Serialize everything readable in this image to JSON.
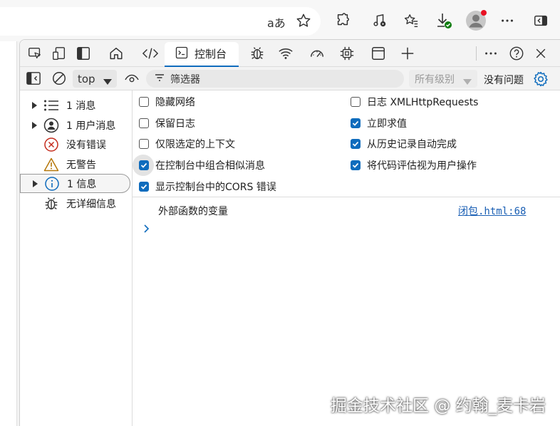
{
  "browser": {
    "read_aloud_glyph": "aあ",
    "icons": [
      "read-aloud-icon",
      "favorite-star-icon",
      "extensions-icon",
      "media-control-icon",
      "favorites-list-icon",
      "downloads-icon",
      "profile-avatar-icon",
      "more-options-icon",
      "sidebar-toggle-icon"
    ],
    "avatar_badge_color": "#e81123",
    "download_badge_color": "#107c10"
  },
  "devtools": {
    "tabs": [
      {
        "id": "inspect",
        "icon": "inspect-element-icon"
      },
      {
        "id": "device",
        "icon": "device-emulation-icon"
      },
      {
        "id": "drawer",
        "icon": "dock-panel-icon"
      },
      {
        "id": "welcome",
        "icon": "home-icon"
      },
      {
        "id": "elements",
        "icon": "code-brackets-icon"
      },
      {
        "id": "console",
        "icon": "console-icon",
        "label": "控制台",
        "active": true
      },
      {
        "id": "sources",
        "icon": "bug-icon"
      },
      {
        "id": "network",
        "icon": "wifi-icon"
      },
      {
        "id": "performance",
        "icon": "gauge-icon"
      },
      {
        "id": "memory",
        "icon": "chip-icon"
      },
      {
        "id": "application",
        "icon": "window-icon"
      },
      {
        "id": "add",
        "icon": "plus-icon"
      }
    ],
    "right_icons": [
      "more-tools-icon",
      "help-icon",
      "close-icon"
    ],
    "accent": "#0f6cbd"
  },
  "console_toolbar": {
    "context": "top",
    "filter_placeholder": "筛选器",
    "level": "所有级别",
    "issues": "没有问题"
  },
  "sidebar": {
    "items": [
      {
        "label": "1 消息",
        "icon": "list-icon",
        "expandable": true
      },
      {
        "label": "1 用户消息",
        "icon": "user-icon",
        "expandable": true
      },
      {
        "label": "没有错误",
        "icon": "error-icon",
        "expandable": false
      },
      {
        "label": "无警告",
        "icon": "warning-icon",
        "expandable": false
      },
      {
        "label": "1 信息",
        "icon": "info-icon",
        "expandable": true,
        "selected": true
      },
      {
        "label": "无详细信息",
        "icon": "bug-icon",
        "expandable": false
      }
    ]
  },
  "settings": {
    "left": [
      {
        "label": "隐藏网络",
        "checked": false
      },
      {
        "label": "保留日志",
        "checked": false
      },
      {
        "label": "仅限选定的上下文",
        "checked": false
      },
      {
        "label": "在控制台中组合相似消息",
        "checked": true
      },
      {
        "label": "显示控制台中的CORS 错误",
        "checked": true
      }
    ],
    "right": [
      {
        "label": "日志 XMLHttpRequests",
        "checked": false
      },
      {
        "label": "立即求值",
        "checked": true
      },
      {
        "label": "从历史记录自动完成",
        "checked": true
      },
      {
        "label": "将代码评估视为用户操作",
        "checked": true
      }
    ]
  },
  "messages": {
    "text": "外部函数的变量",
    "source": "闭包.html:68"
  },
  "watermark": "掘金技术社区 @ 约翰_麦卡岩"
}
